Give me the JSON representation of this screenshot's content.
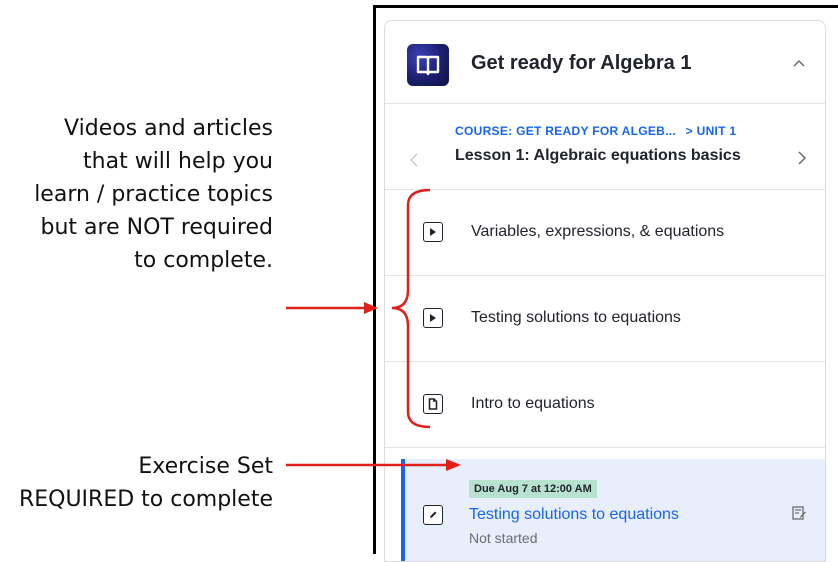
{
  "annotations": {
    "optional_lines": [
      "Videos and articles",
      "that will help you",
      "learn / practice topics",
      "but are NOT required",
      "to complete."
    ],
    "required_lines": [
      "Exercise Set",
      "REQUIRED to complete"
    ]
  },
  "course": {
    "title": "Get ready for Algebra 1",
    "icon": "book-icon",
    "collapse_icon": "chevron-up-icon"
  },
  "lesson_nav": {
    "breadcrumb_course": "COURSE: GET READY FOR ALGEB...",
    "breadcrumb_unit": "> UNIT 1",
    "lesson_title": "Lesson 1: Algebraic equations basics"
  },
  "items": [
    {
      "label": "Variables, expressions, & equations",
      "icon": "play-icon"
    },
    {
      "label": "Testing solutions to equations",
      "icon": "play-icon"
    },
    {
      "label": "Intro to equations",
      "icon": "article-icon"
    }
  ],
  "exercise": {
    "due": "Due Aug 7 at 12:00 AM",
    "title": "Testing solutions to equations",
    "status": "Not started",
    "icon": "pencil-icon"
  },
  "colors": {
    "accent": "#1865f2",
    "annotation_red": "#e0201b",
    "badge_green": "#b7e2cf",
    "exercise_bg": "#e8eefb"
  }
}
